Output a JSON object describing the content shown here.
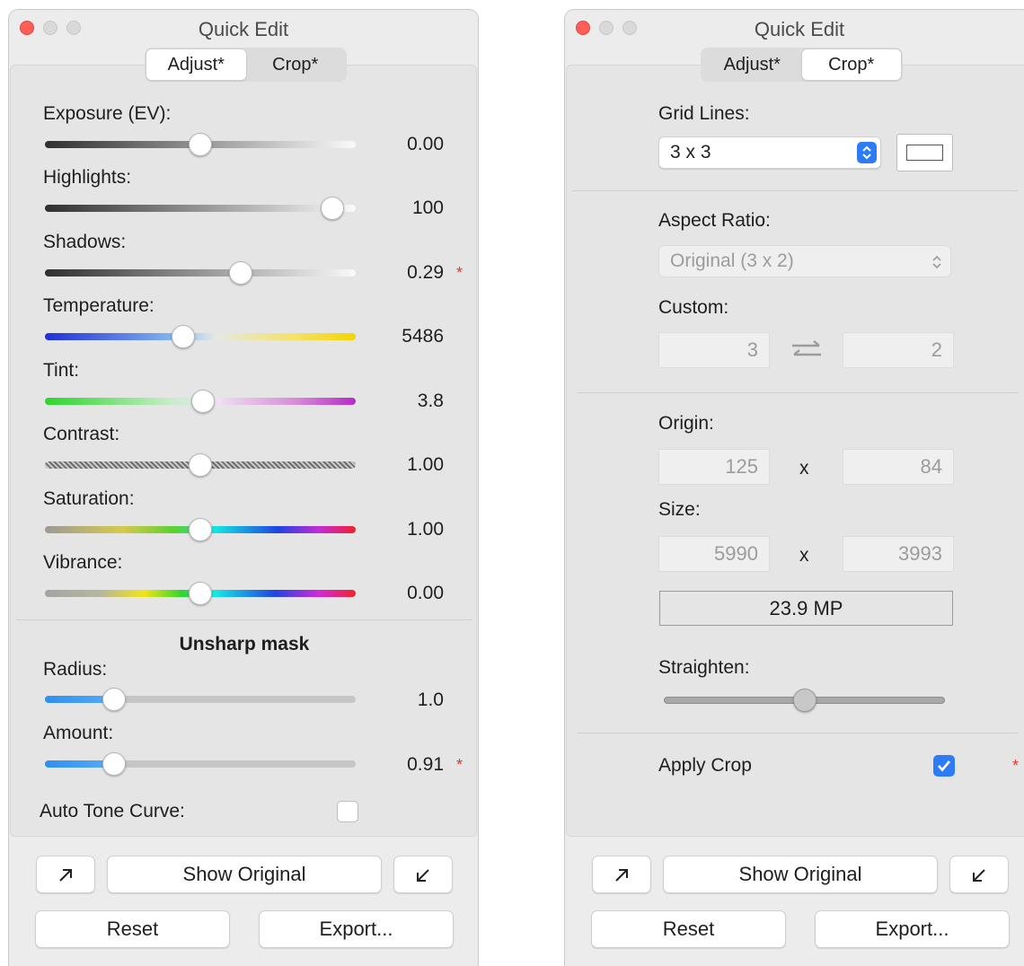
{
  "window_title": "Quick Edit",
  "tabs": {
    "adjust": "Adjust*",
    "crop": "Crop*"
  },
  "adjust": {
    "sliders": [
      {
        "label": "Exposure (EV):",
        "value": "0.00",
        "level": 0.5,
        "modified": false
      },
      {
        "label": "Highlights:",
        "value": "100",
        "level": 0.96,
        "modified": false
      },
      {
        "label": "Shadows:",
        "value": "0.29",
        "level": 0.64,
        "modified": true
      },
      {
        "label": "Temperature:",
        "value": "5486",
        "level": 0.44,
        "modified": false
      },
      {
        "label": "Tint:",
        "value": "3.8",
        "level": 0.51,
        "modified": false
      },
      {
        "label": "Contrast:",
        "value": "1.00",
        "level": 0.5,
        "modified": false
      },
      {
        "label": "Saturation:",
        "value": "1.00",
        "level": 0.5,
        "modified": false
      },
      {
        "label": "Vibrance:",
        "value": "0.00",
        "level": 0.5,
        "modified": false
      }
    ],
    "unsharp_title": "Unsharp mask",
    "unsharp": [
      {
        "label": "Radius:",
        "value": "1.0",
        "level": 0.2,
        "modified": false
      },
      {
        "label": "Amount:",
        "value": "0.91",
        "level": 0.2,
        "modified": true
      }
    ],
    "auto_tone_label": "Auto Tone Curve:",
    "auto_tone_checked": false
  },
  "crop": {
    "grid_lines_label": "Grid Lines:",
    "grid_lines_value": "3 x 3",
    "aspect_ratio_label": "Aspect Ratio:",
    "aspect_ratio_value": "Original (3 x 2)",
    "custom_label": "Custom:",
    "custom_w": "3",
    "custom_h": "2",
    "origin_label": "Origin:",
    "origin_x": "125",
    "origin_y": "84",
    "size_label": "Size:",
    "size_w": "5990",
    "size_h": "3993",
    "x_sep": "x",
    "megapixels": "23.9 MP",
    "straighten_label": "Straighten:",
    "straighten_level": 0.5,
    "apply_crop_label": "Apply Crop",
    "apply_crop_checked": true
  },
  "buttons": {
    "show_original": "Show Original",
    "reset": "Reset",
    "export": "Export..."
  },
  "colors": {
    "accent": "#2b7cf6",
    "modified_star": "#e0362c",
    "close": "#ff5f57"
  }
}
